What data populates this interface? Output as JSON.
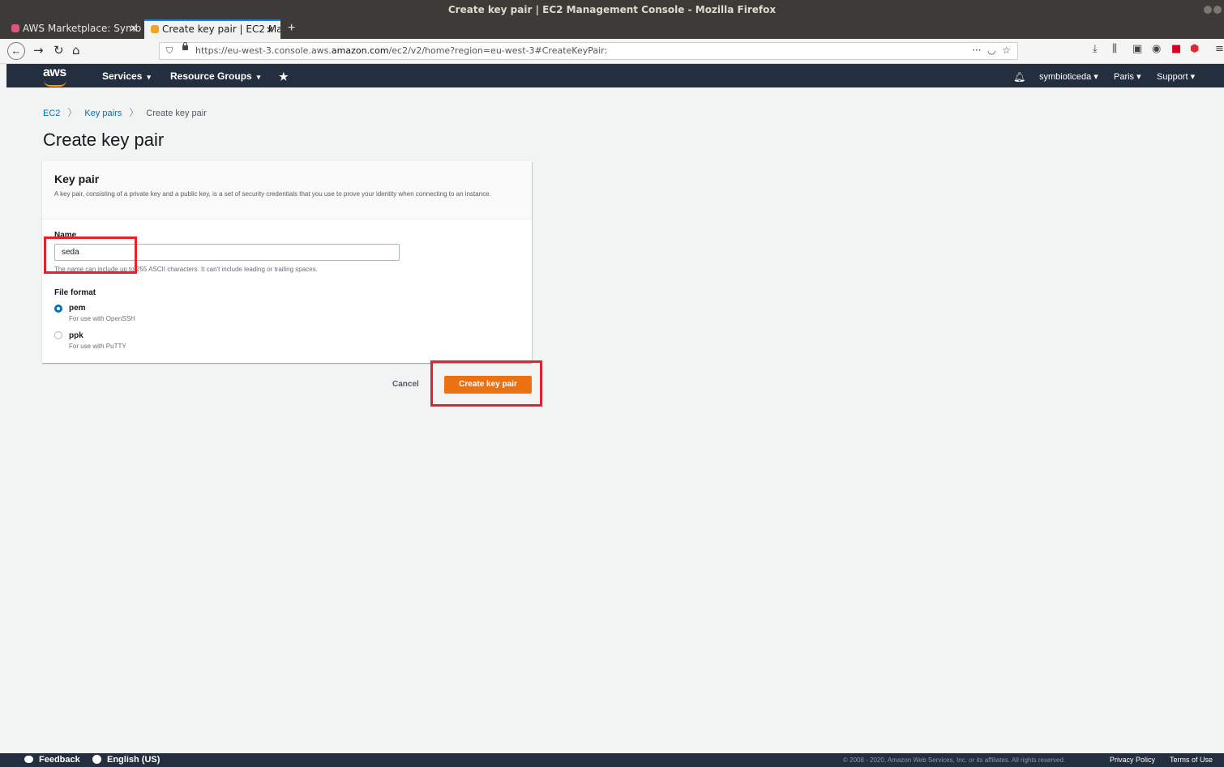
{
  "window": {
    "title": "Create key pair | EC2 Management Console - Mozilla Firefox"
  },
  "tabs": [
    {
      "label": "AWS Marketplace: Symb",
      "close": "✕"
    },
    {
      "label": "Create key pair | EC2 Ma",
      "close": "✕"
    }
  ],
  "new_tab": "+",
  "url": {
    "prefix": "https://eu-west-3.console.aws.",
    "domain": "amazon.com",
    "suffix": "/ec2/v2/home?region=eu-west-3#CreateKeyPair:"
  },
  "aws_nav": {
    "logo": "aws",
    "services": "Services",
    "resource_groups": "Resource Groups",
    "user": "symbioticeda",
    "region": "Paris",
    "support": "Support"
  },
  "breadcrumb": {
    "ec2": "EC2",
    "key_pairs": "Key pairs",
    "current": "Create key pair"
  },
  "page_title": "Create key pair",
  "panel": {
    "title": "Key pair",
    "description": "A key pair, consisting of a private key and a public key, is a set of security credentials that you use to prove your identity when connecting to an instance.",
    "name_label": "Name",
    "name_value": "seda",
    "name_hint": "The name can include up to 255 ASCII characters. It can't include leading or trailing spaces.",
    "file_format_label": "File format",
    "options": [
      {
        "label": "pem",
        "desc": "For use with OpenSSH",
        "selected": true
      },
      {
        "label": "ppk",
        "desc": "For use with PuTTY",
        "selected": false
      }
    ]
  },
  "actions": {
    "cancel": "Cancel",
    "create": "Create key pair"
  },
  "footer": {
    "feedback": "Feedback",
    "language": "English (US)",
    "copyright": "© 2008 - 2020, Amazon Web Services, Inc. or its affiliates. All rights reserved.",
    "privacy": "Privacy Policy",
    "terms": "Terms of Use"
  },
  "colors": {
    "primary_button": "#ec7211",
    "annotation": "#e8202a",
    "aws_nav": "#232f3e",
    "link": "#0073bb"
  }
}
